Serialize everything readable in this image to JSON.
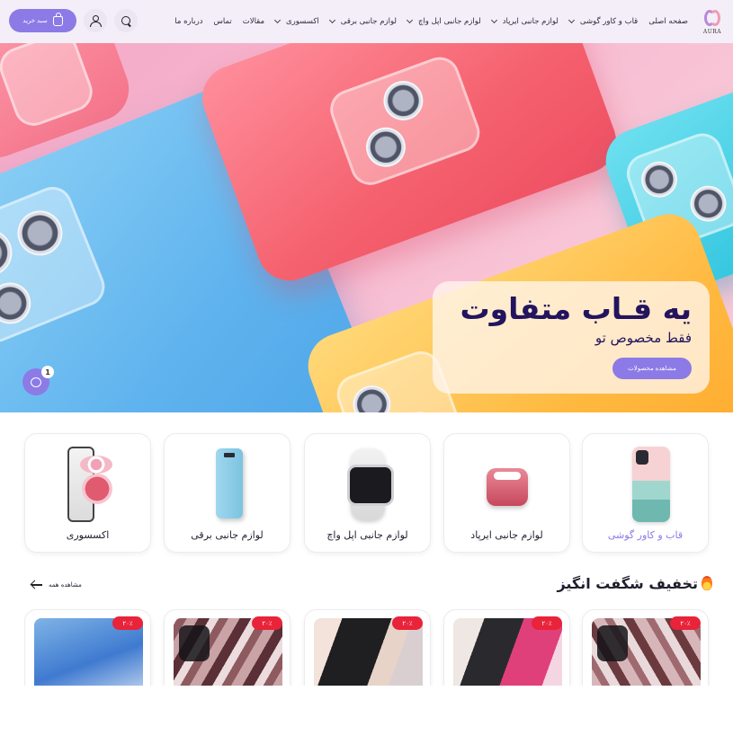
{
  "header": {
    "logo_text": "AURA",
    "nav": [
      {
        "label": "صفحه اصلی",
        "dropdown": false
      },
      {
        "label": "قاب و کاور گوشی",
        "dropdown": true
      },
      {
        "label": "لوازم جانبی ایرپاد",
        "dropdown": true
      },
      {
        "label": "لوازم جانبی اپل واچ",
        "dropdown": true
      },
      {
        "label": "لوازم جانبی برقی",
        "dropdown": true
      },
      {
        "label": "اکسسوری",
        "dropdown": true
      },
      {
        "label": "مقالات",
        "dropdown": false
      },
      {
        "label": "تماس",
        "dropdown": false
      },
      {
        "label": "درباره ما",
        "dropdown": false
      }
    ],
    "cart_label": "سبد خرید",
    "accent": "#8c7ae6"
  },
  "hero": {
    "title": "یه قـاب متفاوت",
    "subtitle": "فقط مخصوص تو",
    "cta": "مشاهده محصولات",
    "chat_badge": "1"
  },
  "categories": [
    {
      "label": "قاب و کاور گوشی",
      "active": true
    },
    {
      "label": "لوازم جانبی ایرپاد",
      "active": false
    },
    {
      "label": "لوازم جانبی اپل واچ",
      "active": false
    },
    {
      "label": "لوازم جانبی برقی",
      "active": false
    },
    {
      "label": "اکسسوری",
      "active": false
    }
  ],
  "deals": {
    "title": "تخفیف شگفت انگیز",
    "see_all": "مشاهده همه",
    "products": [
      {
        "badge": "۲۰٪"
      },
      {
        "badge": "۲۰٪"
      },
      {
        "badge": "۲۰٪"
      },
      {
        "badge": "۲۰٪"
      },
      {
        "badge": "۲۰٪"
      }
    ]
  }
}
